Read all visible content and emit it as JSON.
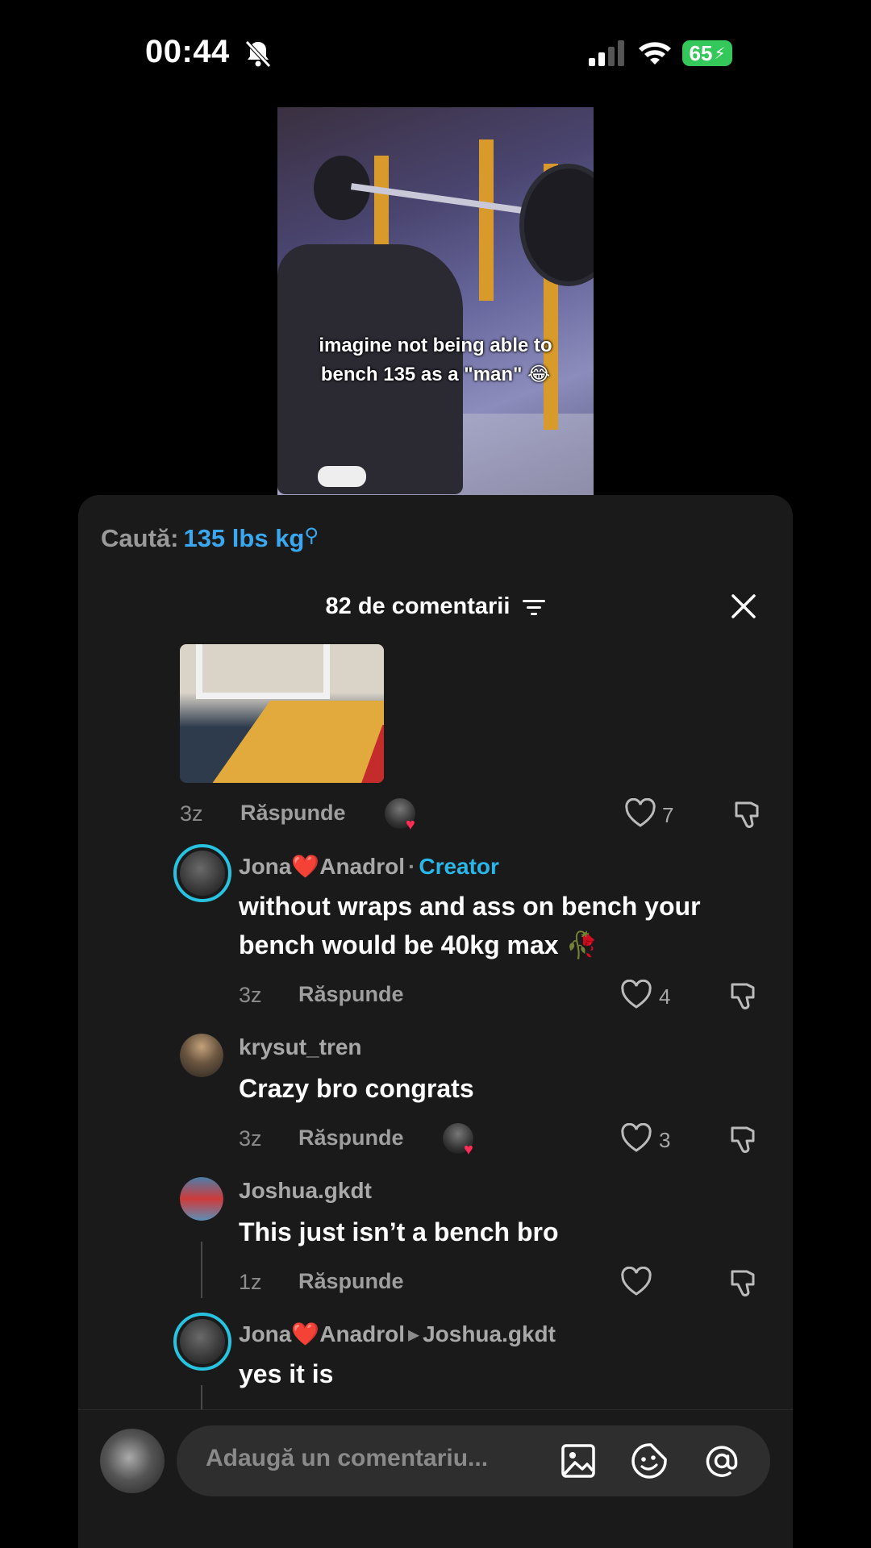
{
  "status_bar": {
    "time": "00:44",
    "battery": "65"
  },
  "video": {
    "caption_line1": "imagine not being able to",
    "caption_line2": "bench 135 as a \"man\" 😂"
  },
  "search": {
    "label": "Caută:",
    "query": "135 lbs kg"
  },
  "comments_header": {
    "title": "82 de comentarii"
  },
  "comments": [
    {
      "age": "3z",
      "reply_label": "Răspunde",
      "likes": "7"
    },
    {
      "username_a": "Jona",
      "username_b": "Anadrol",
      "badge": "Creator",
      "text_line1": "without wraps and ass on bench your",
      "text_line2": "bench would be 40kg max 🥀",
      "age": "3z",
      "reply_label": "Răspunde",
      "likes": "4"
    },
    {
      "username": "krysut_tren",
      "text": "Crazy bro congrats",
      "age": "3z",
      "reply_label": "Răspunde",
      "likes": "3"
    },
    {
      "username": "Joshua.gkdt",
      "text": "This just isn’t a bench bro",
      "age": "1z",
      "reply_label": "Răspunde"
    },
    {
      "username_a": "Jona",
      "username_b": "Anadrol",
      "reply_to": "Joshua.gkdt",
      "text": "yes it is"
    }
  ],
  "input": {
    "placeholder": "Adaugă un comentariu..."
  },
  "colors": {
    "accent": "#3aa8f0",
    "creator": "#29b6e8",
    "battery": "#34c759",
    "heart": "#ff2d3b"
  }
}
